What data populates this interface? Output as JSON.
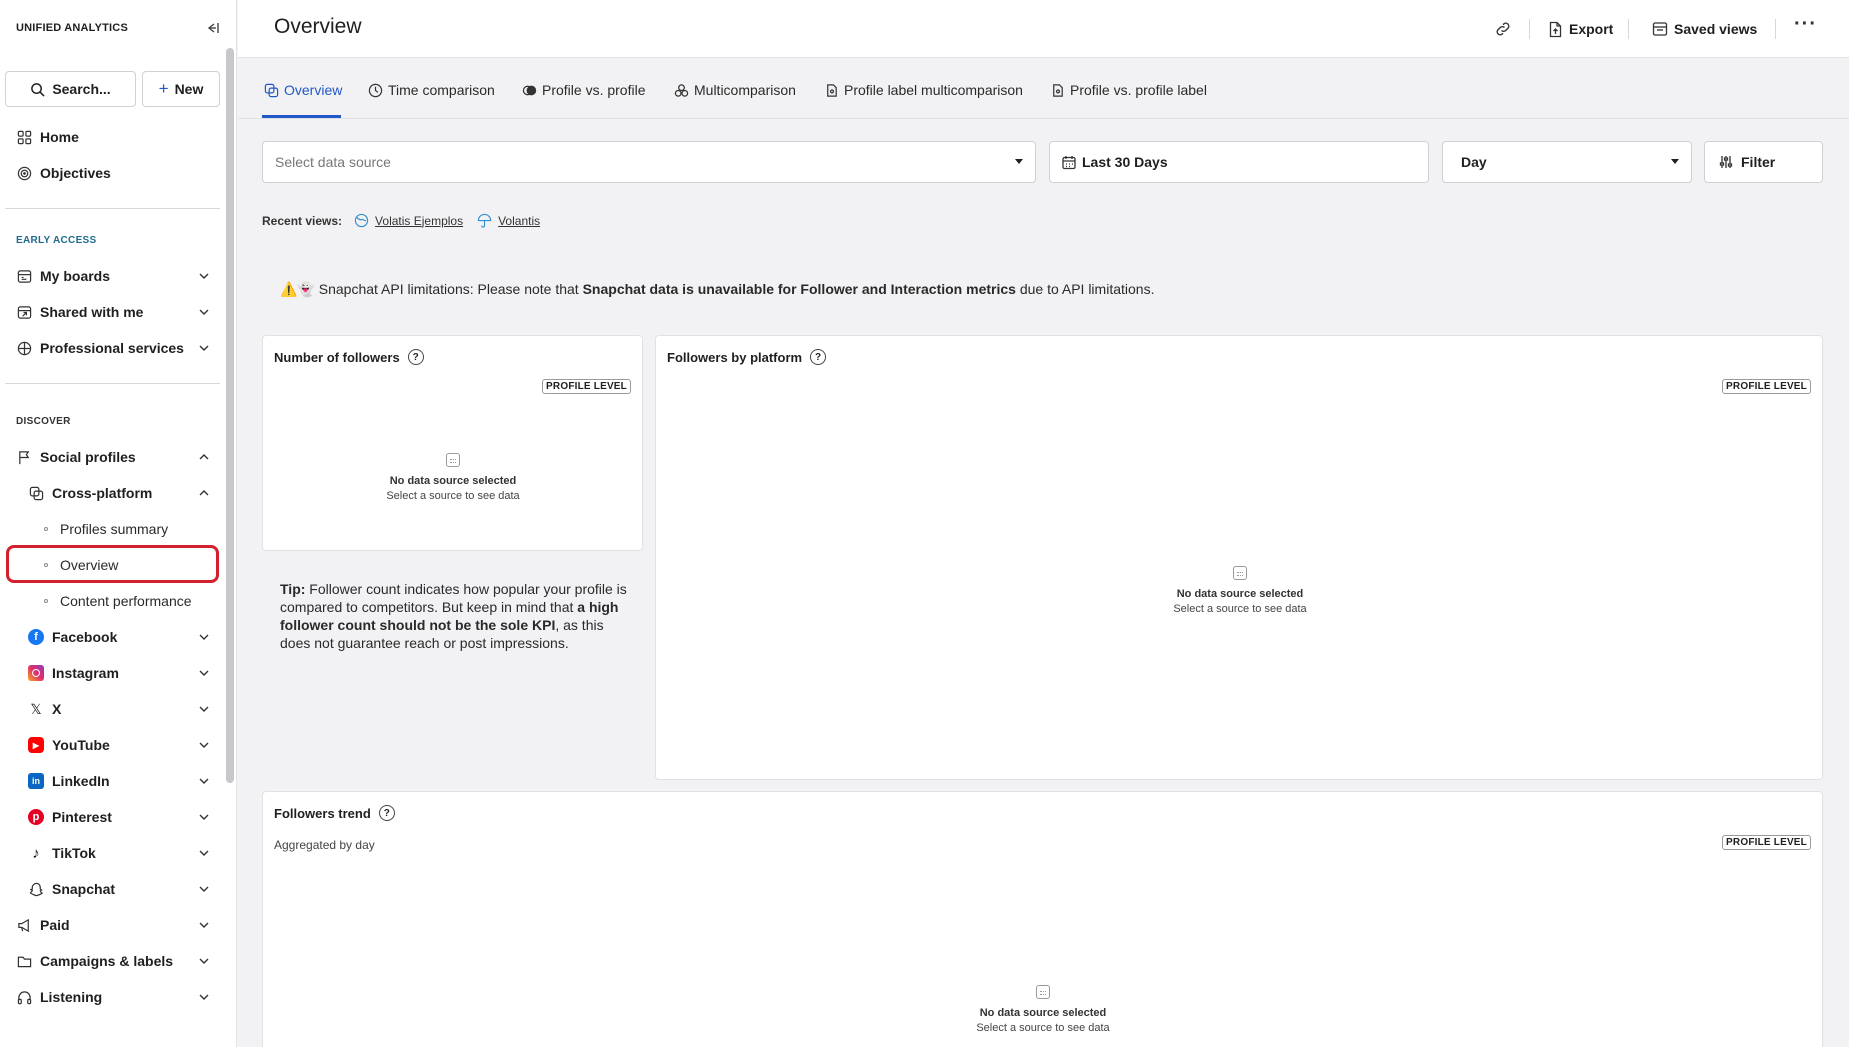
{
  "sidebar": {
    "brand": "UNIFIED ANALYTICS",
    "search_label": "Search...",
    "new_label": "New",
    "home": "Home",
    "objectives": "Objectives",
    "early_access_label": "EARLY ACCESS",
    "my_boards": "My boards",
    "shared_with_me": "Shared with me",
    "professional_services": "Professional services",
    "discover_label": "DISCOVER",
    "social_profiles": "Social profiles",
    "cross_platform": "Cross-platform",
    "profiles_summary": "Profiles summary",
    "overview": "Overview",
    "content_performance": "Content performance",
    "facebook": "Facebook",
    "instagram": "Instagram",
    "x": "X",
    "youtube": "YouTube",
    "linkedin": "LinkedIn",
    "pinterest": "Pinterest",
    "tiktok": "TikTok",
    "snapchat": "Snapchat",
    "paid": "Paid",
    "campaigns_labels": "Campaigns & labels",
    "listening": "Listening"
  },
  "header": {
    "title": "Overview",
    "export": "Export",
    "saved_views": "Saved views"
  },
  "tabs": {
    "overview": "Overview",
    "time_comparison": "Time comparison",
    "profile_vs_profile": "Profile vs. profile",
    "multicomparison": "Multicomparison",
    "profile_label_multicomparison": "Profile label multicomparison",
    "profile_vs_profile_label": "Profile vs. profile label"
  },
  "filters": {
    "data_source_placeholder": "Select data source",
    "date_range": "Last 30 Days",
    "granularity": "Day",
    "filter": "Filter"
  },
  "recent": {
    "label": "Recent views:",
    "view1": "Volatis Ejemplos",
    "view2": "Volantis"
  },
  "notice": {
    "icons": "⚠️👻",
    "prefix": " Snapchat API limitations: Please note that ",
    "bold": "Snapchat data is unavailable for Follower and Interaction metrics",
    "suffix": " due to API limitations."
  },
  "cards": {
    "followers": {
      "title": "Number of followers",
      "badge": "PROFILE LEVEL",
      "empty_title": "No data source selected",
      "empty_sub": "Select a source to see data"
    },
    "by_platform": {
      "title": "Followers by platform",
      "badge": "PROFILE LEVEL",
      "empty_title": "No data source selected",
      "empty_sub": "Select a source to see data"
    },
    "trend": {
      "title": "Followers trend",
      "aggregated": "Aggregated by day",
      "badge": "PROFILE LEVEL",
      "empty_title": "No data source selected",
      "empty_sub": "Select a source to see data"
    }
  },
  "tip": {
    "label": "Tip:",
    "text1": " Follower count indicates how popular your profile is compared to competitors. But keep in mind that ",
    "bold": "a high follower count should not be the sole KPI",
    "text2": ", as this does not guarantee reach or post impressions."
  },
  "colors": {
    "accent": "#2157c9",
    "highlight": "#d2202e",
    "facebook": "#1877f2",
    "youtube": "#ff0000",
    "linkedin": "#0a66c2",
    "pinterest": "#e60023"
  }
}
